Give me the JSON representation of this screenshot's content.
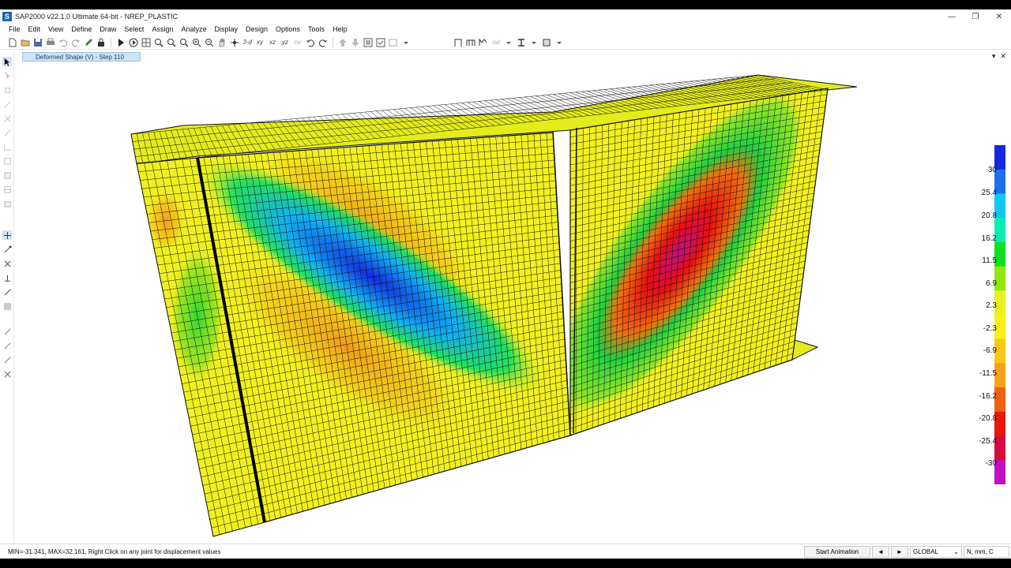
{
  "window": {
    "title": "SAP2000 v22.1.0 Ultimate 64-bit - NREP_PLASTIC",
    "logo_letter": "S",
    "controls": {
      "minimize": "—",
      "restore": "❐",
      "close": "✕"
    }
  },
  "menu": [
    "File",
    "Edit",
    "View",
    "Define",
    "Draw",
    "Select",
    "Assign",
    "Analyze",
    "Display",
    "Design",
    "Options",
    "Tools",
    "Help"
  ],
  "toolbar": {
    "view_labels": {
      "three_d": "3-d",
      "xy": "xy",
      "xz": "xz",
      "yz": "yz",
      "nv": "nv",
      "nd": "nd"
    }
  },
  "view_tab": {
    "title": "Deformed Shape (V) - Step 110",
    "controls": {
      "dropdown": "▾",
      "close": "✕"
    }
  },
  "legend": {
    "labels": [
      "30",
      "25.4",
      "20.8",
      "16.2",
      "11.5",
      "6.9",
      "2.3",
      "-2.3",
      "-6.9",
      "-11.5",
      "-16.2",
      "-20.8",
      "-25.4",
      "-30"
    ],
    "colors": [
      "#1428e0",
      "#1e6ef0",
      "#10c8f0",
      "#08f0b0",
      "#10e020",
      "#90e810",
      "#e8f020",
      "#f8f018",
      "#f8c818",
      "#f8a018",
      "#f06010",
      "#e81808",
      "#d80a40",
      "#c010c0"
    ]
  },
  "status": {
    "message": "MIN=-31.341, MAX=32.161, Right Click on any joint for displacement values",
    "start_animation": "Start Animation",
    "prev": "◄",
    "next": "►",
    "coord_system": "GLOBAL",
    "units": "N, mm, C"
  }
}
